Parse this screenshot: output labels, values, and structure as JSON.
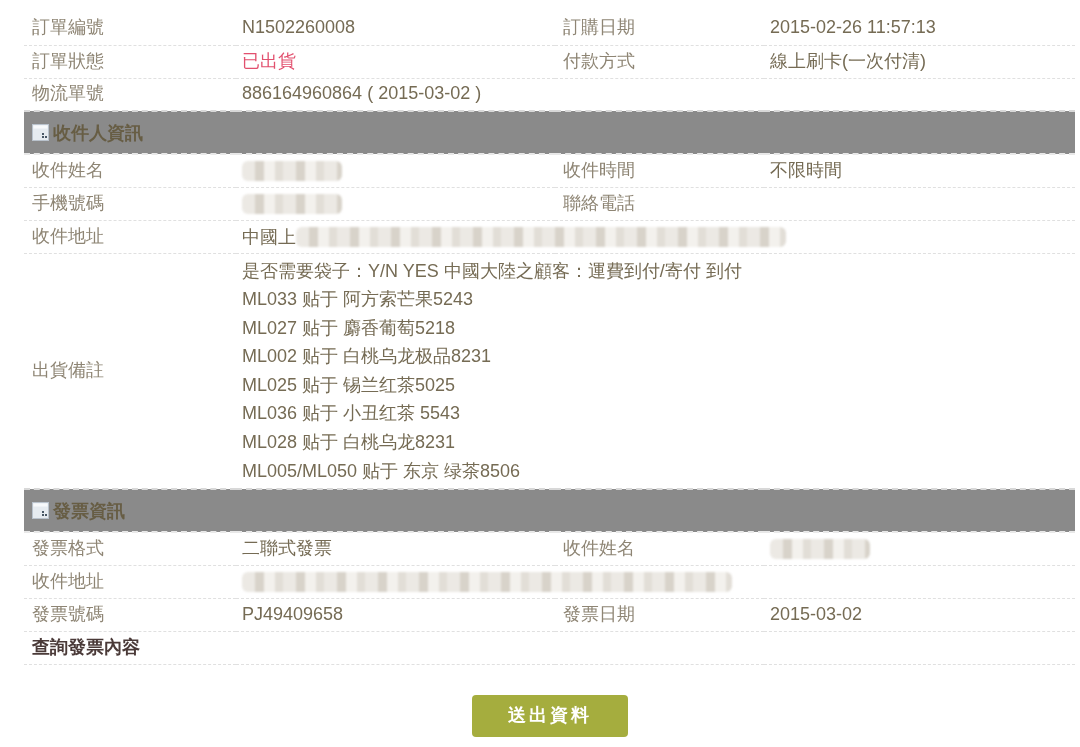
{
  "order_info": {
    "rows": [
      {
        "cells": [
          {
            "kind": "label",
            "text": "訂單編號"
          },
          {
            "kind": "value",
            "text": "N1502260008"
          },
          {
            "kind": "label",
            "text": "訂購日期"
          },
          {
            "kind": "value",
            "text": "2015-02-26 11:57:13"
          }
        ]
      },
      {
        "cells": [
          {
            "kind": "label",
            "text": "訂單狀態"
          },
          {
            "kind": "status",
            "text": "已出貨"
          },
          {
            "kind": "label",
            "text": "付款方式"
          },
          {
            "kind": "value",
            "text": "線上刷卡(一次付清)"
          }
        ]
      },
      {
        "cells": [
          {
            "kind": "label",
            "text": "物流單號"
          },
          {
            "kind": "value",
            "text": "886164960864 ( 2015-03-02 )"
          }
        ]
      }
    ]
  },
  "sections": [
    {
      "title": "收件人資訊",
      "rows": [
        {
          "cells": [
            {
              "kind": "label",
              "text": "收件姓名"
            },
            {
              "kind": "redacted"
            },
            {
              "kind": "label",
              "text": "收件時間"
            },
            {
              "kind": "value",
              "text": "不限時間"
            }
          ]
        },
        {
          "cells": [
            {
              "kind": "label",
              "text": "手機號碼"
            },
            {
              "kind": "redacted"
            },
            {
              "kind": "label",
              "text": "聯絡電話"
            }
          ]
        },
        {
          "cells": [
            {
              "kind": "label",
              "text": "收件地址"
            },
            {
              "kind": "redacted",
              "text": "中國上",
              "colspan": 3
            }
          ]
        },
        {
          "cells": [
            {
              "kind": "label",
              "text": "出貨備註"
            },
            {
              "kind": "lines",
              "colspan": 3,
              "lines": [
                "是否需要袋子：Y/N YES 中國大陸之顧客：運費到付/寄付 到付",
                "ML033 贴于 阿方索芒果5243",
                "ML027 贴于 麝香葡萄5218",
                "ML002 贴于 白桃乌龙极品8231",
                "ML025 贴于 锡兰红茶5025",
                "ML036 贴于 小丑红茶 5543",
                "ML028 贴于 白桃乌龙8231",
                "ML005/ML050 贴于 东京 绿茶8506"
              ]
            }
          ]
        }
      ]
    },
    {
      "title": "發票資訊",
      "rows": [
        {
          "cells": [
            {
              "kind": "label",
              "text": "發票格式"
            },
            {
              "kind": "value",
              "text": "二聯式發票"
            },
            {
              "kind": "label",
              "text": "收件姓名"
            },
            {
              "kind": "redacted"
            }
          ]
        },
        {
          "cells": [
            {
              "kind": "label",
              "text": "收件地址"
            },
            {
              "kind": "redacted",
              "colspan": 3
            }
          ]
        },
        {
          "cells": [
            {
              "kind": "label",
              "text": "發票號碼"
            },
            {
              "kind": "value",
              "text": "PJ49409658"
            },
            {
              "kind": "label",
              "text": "發票日期"
            },
            {
              "kind": "value",
              "text": "2015-03-02"
            }
          ]
        },
        {
          "cells": [
            {
              "kind": "link",
              "text": "查詢發票內容"
            }
          ]
        }
      ]
    }
  ],
  "submit_button": {
    "label": "送出資料"
  }
}
